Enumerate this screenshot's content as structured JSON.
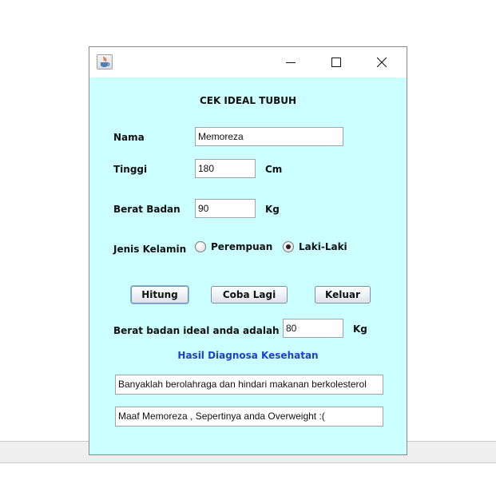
{
  "window": {
    "icon": "java-coffee-icon"
  },
  "form": {
    "title": "CEK IDEAL TUBUH",
    "nama_label": "Nama",
    "nama_value": "Memoreza",
    "tinggi_label": "Tinggi",
    "tinggi_value": "180",
    "tinggi_unit": "Cm",
    "berat_label": "Berat Badan",
    "berat_value": "90",
    "berat_unit": "Kg",
    "jenis_label": "Jenis Kelamin",
    "radio_perempuan": "Perempuan",
    "radio_laki": "Laki-Laki",
    "selected_gender": "Laki-Laki"
  },
  "buttons": {
    "hitung": "Hitung",
    "coba_lagi": "Coba Lagi",
    "keluar": "Keluar"
  },
  "result": {
    "ideal_label": "Berat badan ideal anda adalah",
    "ideal_value": "80",
    "ideal_unit": "Kg",
    "diagnosa_title": "Hasil Diagnosa Kesehatan",
    "diagnosa_text": "Banyaklah berolahraga dan hindari makanan berkolesterol",
    "message_text": "Maaf Memoreza , Sepertinya anda Overweight :("
  },
  "colors": {
    "window_bg": "#ccffff",
    "diagnosa_title": "#1a3fd1"
  }
}
